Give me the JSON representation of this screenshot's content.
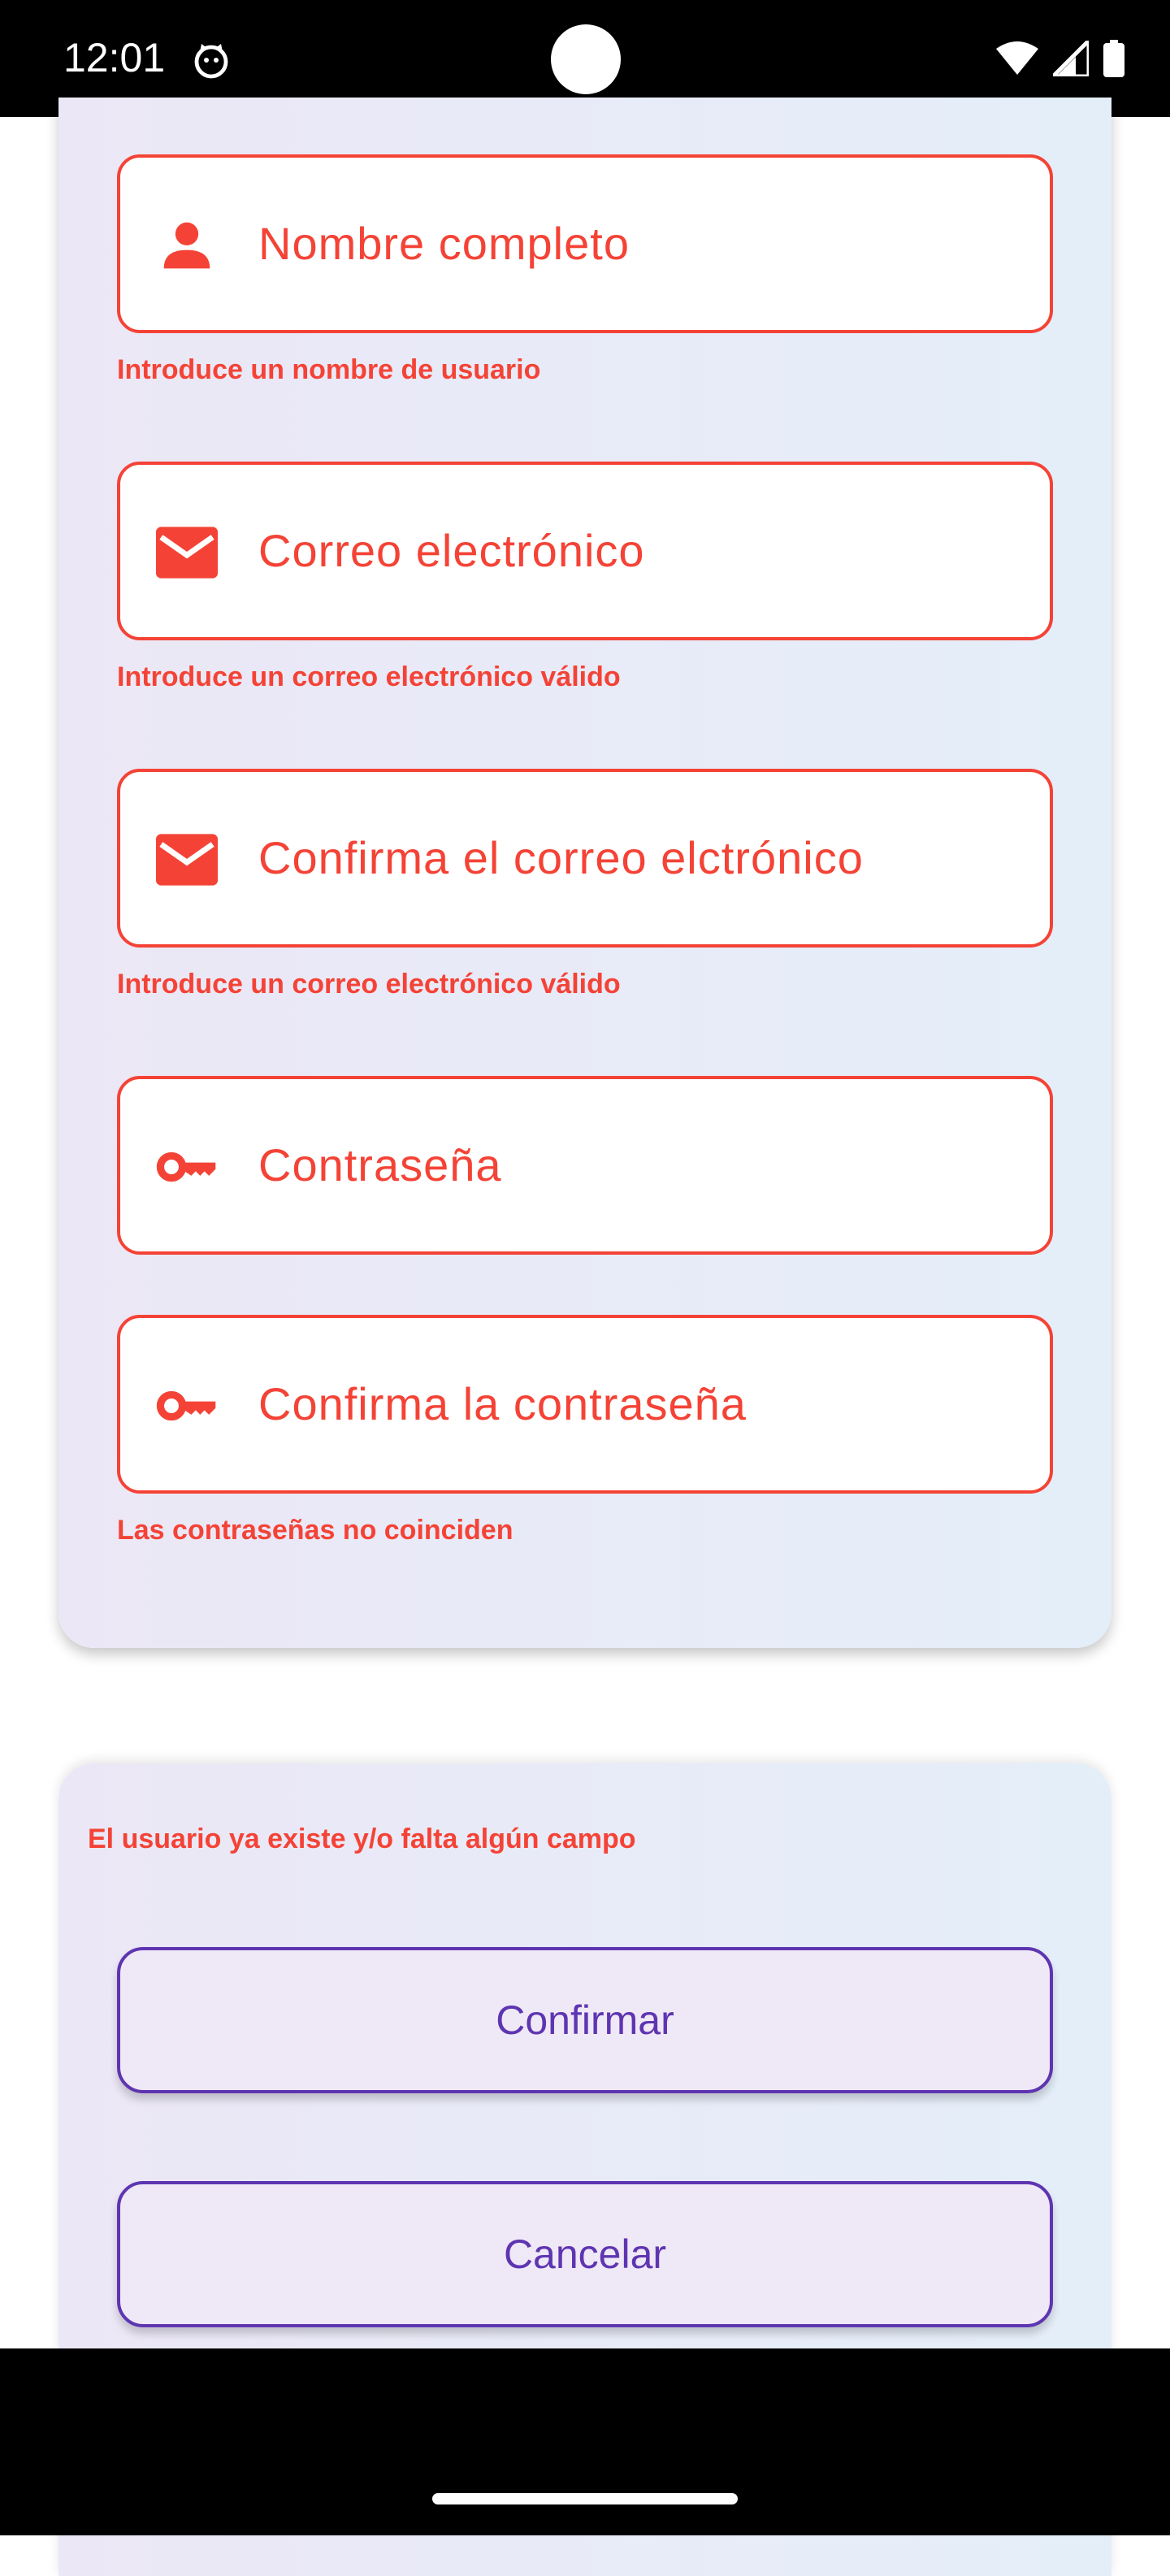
{
  "status_bar": {
    "time": "12:01",
    "icons": [
      "cat-notification-icon",
      "wifi-icon",
      "cell-signal-icon",
      "battery-icon"
    ]
  },
  "form": {
    "fields": [
      {
        "placeholder": "Nombre completo",
        "icon": "person-icon",
        "error": "Introduce un nombre de usuario"
      },
      {
        "placeholder": "Correo electrónico",
        "icon": "mail-icon",
        "error": "Introduce un correo electrónico válido"
      },
      {
        "placeholder": "Confirma el correo elctrónico",
        "icon": "mail-icon",
        "error": "Introduce un correo electrónico válido"
      },
      {
        "placeholder": "Contraseña",
        "icon": "key-icon",
        "error": ""
      },
      {
        "placeholder": "Confirma la contraseña",
        "icon": "key-icon",
        "error": "Las contraseñas no coinciden"
      }
    ]
  },
  "actions": {
    "general_error": "El usuario ya existe y/o falta algún campo",
    "confirm_label": "Confirmar",
    "cancel_label": "Cancelar"
  },
  "colors": {
    "error": "#f44336",
    "primary": "#5e35b1",
    "button_bg": "#efe8f6"
  }
}
